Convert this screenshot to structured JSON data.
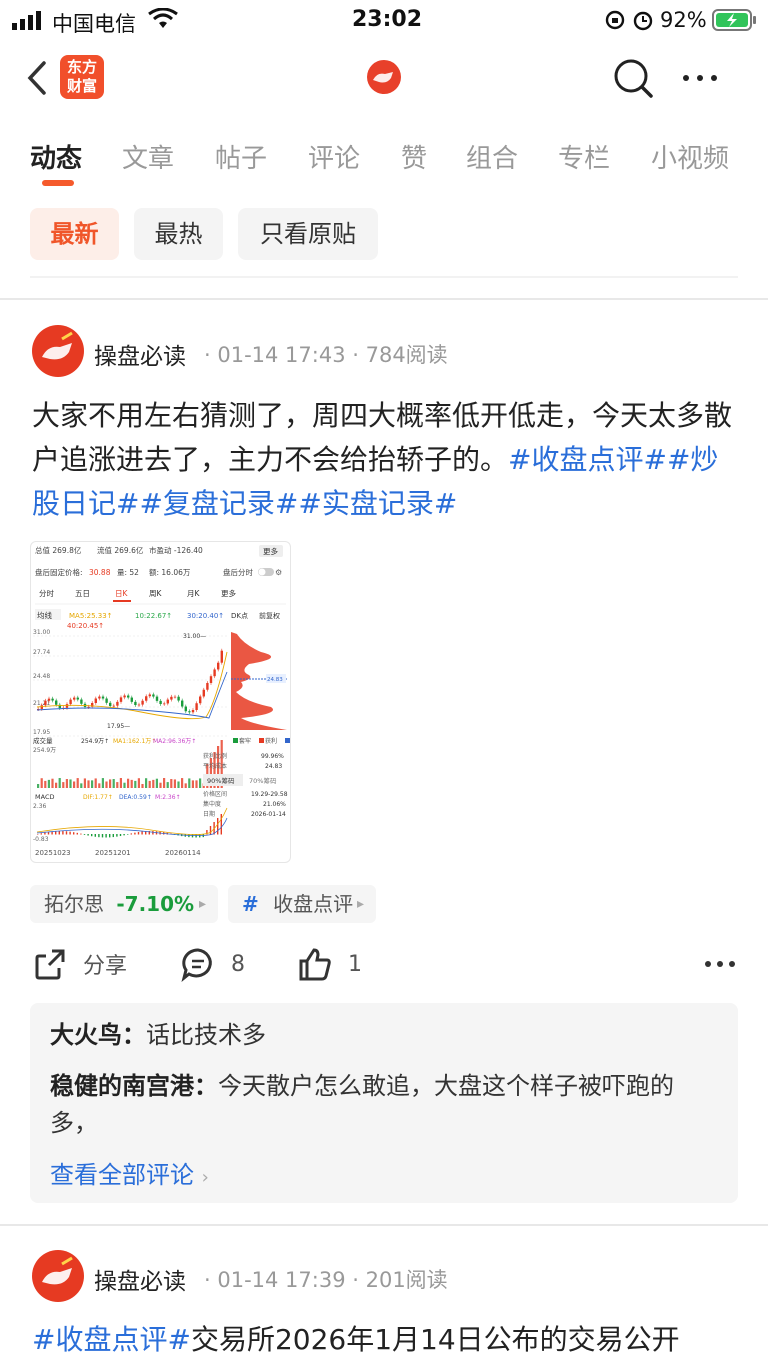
{
  "status_bar": {
    "carrier": "中国电信",
    "time": "23:02",
    "battery": "92%"
  },
  "header": {
    "logo_text": "东方财富"
  },
  "tabs": [
    {
      "label": "动态"
    },
    {
      "label": "文章"
    },
    {
      "label": "帖子"
    },
    {
      "label": "评论"
    },
    {
      "label": "赞"
    },
    {
      "label": "组合"
    },
    {
      "label": "专栏"
    },
    {
      "label": "小视频"
    }
  ],
  "filters": [
    {
      "label": "最新"
    },
    {
      "label": "最热"
    },
    {
      "label": "只看原贴"
    }
  ],
  "post1": {
    "author": "操盘必读",
    "meta": "· 01-14 17:43 · 784阅读",
    "text": "大家不用左右猜测了，周四大概率低开低走，今天太多散户追涨进去了，主力不会给抬轿子的。",
    "tags": "#收盘点评##炒股日记##复盘记录##实盘记录#",
    "chart": {
      "total_value": "总值 269.8亿",
      "float_value": "流值 269.6亿",
      "pe": "市盈动 -126.40",
      "more": "更多",
      "after_price": "盘后固定价格:",
      "price": "30.88",
      "vol": "量: 52",
      "amount": "额: 16.06万",
      "after_time": "盘后分时",
      "periods": [
        "分时",
        "五日",
        "日K",
        "周K",
        "月K",
        "更多"
      ],
      "ma_label": "均线",
      "ma5": "MA5:25.33↑",
      "ma10": "10:22.67↑",
      "ma30": "30:20.40↑",
      "ma40": "40:20.45↑",
      "dk": "DK点",
      "fq": "前复权",
      "y_ticks": [
        "31.00",
        "27.74",
        "24.48",
        "21.21",
        "17.95"
      ],
      "high": "31.00",
      "low": "17.95",
      "vol_label": "成交量",
      "vol_val": "254.9万↑",
      "vol_ma1": "MA1:162.1万↑",
      "vol_ma2": "MA2:96.36万↑",
      "vol_y": "254.9万",
      "macd_label": "MACD",
      "dif": "DIF:1.77↑",
      "dea": "DEA:0.59↑",
      "m": "M:2.36↑",
      "macd_y": "2.36",
      "macd_low": "-0.83",
      "dates": [
        "20251023",
        "20251201",
        "20260114"
      ],
      "legend": [
        "套牢",
        "获利",
        "平均"
      ],
      "cost_rows": [
        [
          "获利比例",
          "99.96%"
        ],
        [
          "平均成本",
          "24.83"
        ]
      ],
      "chip_tabs": [
        "90%筹码",
        "70%筹码"
      ],
      "range_rows": [
        [
          "价格区间",
          "19.29-29.58"
        ],
        [
          "集中度",
          "21.06%"
        ],
        [
          "日期",
          "2026-01-14"
        ]
      ],
      "avg_marker": "24.83"
    },
    "stock": {
      "name": "拓尔思",
      "change": "-7.10%"
    },
    "topic": "收盘点评",
    "actions": {
      "share": "分享",
      "comments": "8",
      "likes": "1"
    },
    "comments": [
      {
        "user": "大火鸟：",
        "text": "话比技术多"
      },
      {
        "user": "稳健的南宫港：",
        "text": "今天散户怎么敢追，大盘这个样子被吓跑的多，"
      }
    ],
    "view_all": "查看全部评论"
  },
  "post2": {
    "author": "操盘必读",
    "meta": "· 01-14 17:39 · 201阅读",
    "tag": "#收盘点评#",
    "text": "交易所2026年1月14日公布的交易公开"
  },
  "colors": {
    "accent": "#f0562a",
    "link": "#2a6ed9",
    "stock_down": "#1a9c3c"
  }
}
